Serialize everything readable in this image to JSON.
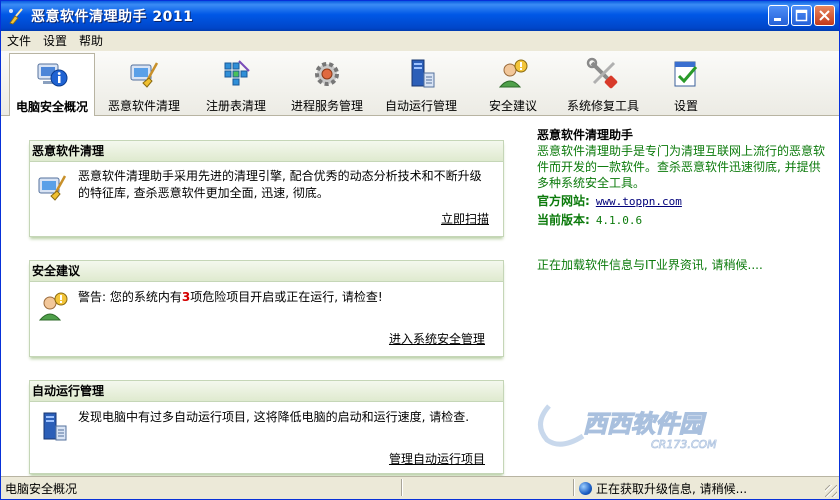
{
  "window": {
    "title": "恶意软件清理助手 2011"
  },
  "menu": [
    "文件",
    "设置",
    "帮助"
  ],
  "tabs": [
    {
      "label": "电脑安全概况",
      "icon": "info-computer-icon",
      "active": true
    },
    {
      "label": "恶意软件清理",
      "icon": "malware-clean-icon",
      "active": false
    },
    {
      "label": "注册表清理",
      "icon": "registry-icon",
      "active": false
    },
    {
      "label": "进程服务管理",
      "icon": "process-gear-icon",
      "active": false
    },
    {
      "label": "自动运行管理",
      "icon": "autorun-icon",
      "active": false
    },
    {
      "label": "安全建议",
      "icon": "security-advice-icon",
      "active": false
    },
    {
      "label": "系统修复工具",
      "icon": "repair-tools-icon",
      "active": false
    },
    {
      "label": "设置",
      "icon": "settings-icon",
      "active": false
    }
  ],
  "panels": {
    "malware": {
      "title": "恶意软件清理",
      "text": "恶意软件清理助手采用先进的清理引擎, 配合优秀的动态分析技术和不断升级的特征库, 查杀恶意软件更加全面, 迅速, 彻底。",
      "link": "立即扫描"
    },
    "security": {
      "title": "安全建议",
      "text_before": "警告: 您的系统内有",
      "count": "3",
      "text_after": "项危险项目开启或正在运行, 请检查!",
      "link": "进入系统安全管理"
    },
    "autorun": {
      "title": "自动运行管理",
      "text": "发现电脑中有过多自动运行项目, 这将降低电脑的启动和运行速度, 请检查.",
      "link": "管理自动运行项目"
    }
  },
  "info": {
    "title": "恶意软件清理助手",
    "description": "恶意软件清理助手是专门为清理互联网上流行的恶意软件而开发的一款软件。查杀恶意软件迅速彻底, 并提供多种系统安全工具。",
    "website_label": "官方网站:",
    "website": "www.toppn.com",
    "version_label": "当前版本:",
    "version": "4.1.0.6",
    "loading": "正在加载软件信息与IT业界资讯, 请稍候...."
  },
  "watermark": {
    "name": "西西软件园",
    "url": "CR173.COM"
  },
  "status": {
    "left": "电脑安全概况",
    "right": "正在获取升级信息, 请稍候..."
  }
}
